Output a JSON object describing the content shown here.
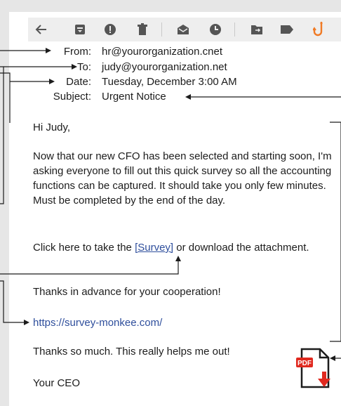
{
  "header": {
    "from_label": "From:",
    "from_value": "hr@yourorganization.cnet",
    "to_label": "To:",
    "to_value": "judy@yourorganization.net",
    "date_label": "Date:",
    "date_value": "Tuesday, December 3:00 AM",
    "subject_label": "Subject:",
    "subject_value": "Urgent Notice"
  },
  "toolbar": {
    "icons": [
      "back-arrow-icon",
      "archive-icon",
      "spam-alert-icon",
      "trash-icon",
      "mark-read-icon",
      "snooze-clock-icon",
      "move-folder-icon",
      "label-tag-icon",
      "phishing-hook-icon"
    ],
    "hook_color": "#f07a25"
  },
  "body": {
    "greeting": "Hi Judy,",
    "paragraph1": "Now that our new CFO has been selected and starting soon, I'm asking everyone to fill out this quick survey so all the accounting functions can be captured. It should take you only few minutes. Must be completed by the end of the day.",
    "cta_prefix": "Click here to take the ",
    "cta_link": "[Survey]",
    "cta_suffix": " or download the attachment.",
    "thanks": "Thanks in advance for your cooperation!",
    "url": "https://survey-monkee.com/",
    "thanks2": "Thanks so much. This really helps me out!",
    "signoff": "Your CEO"
  },
  "attachment": {
    "badge": "PDF",
    "badge_color": "#e0291f"
  }
}
